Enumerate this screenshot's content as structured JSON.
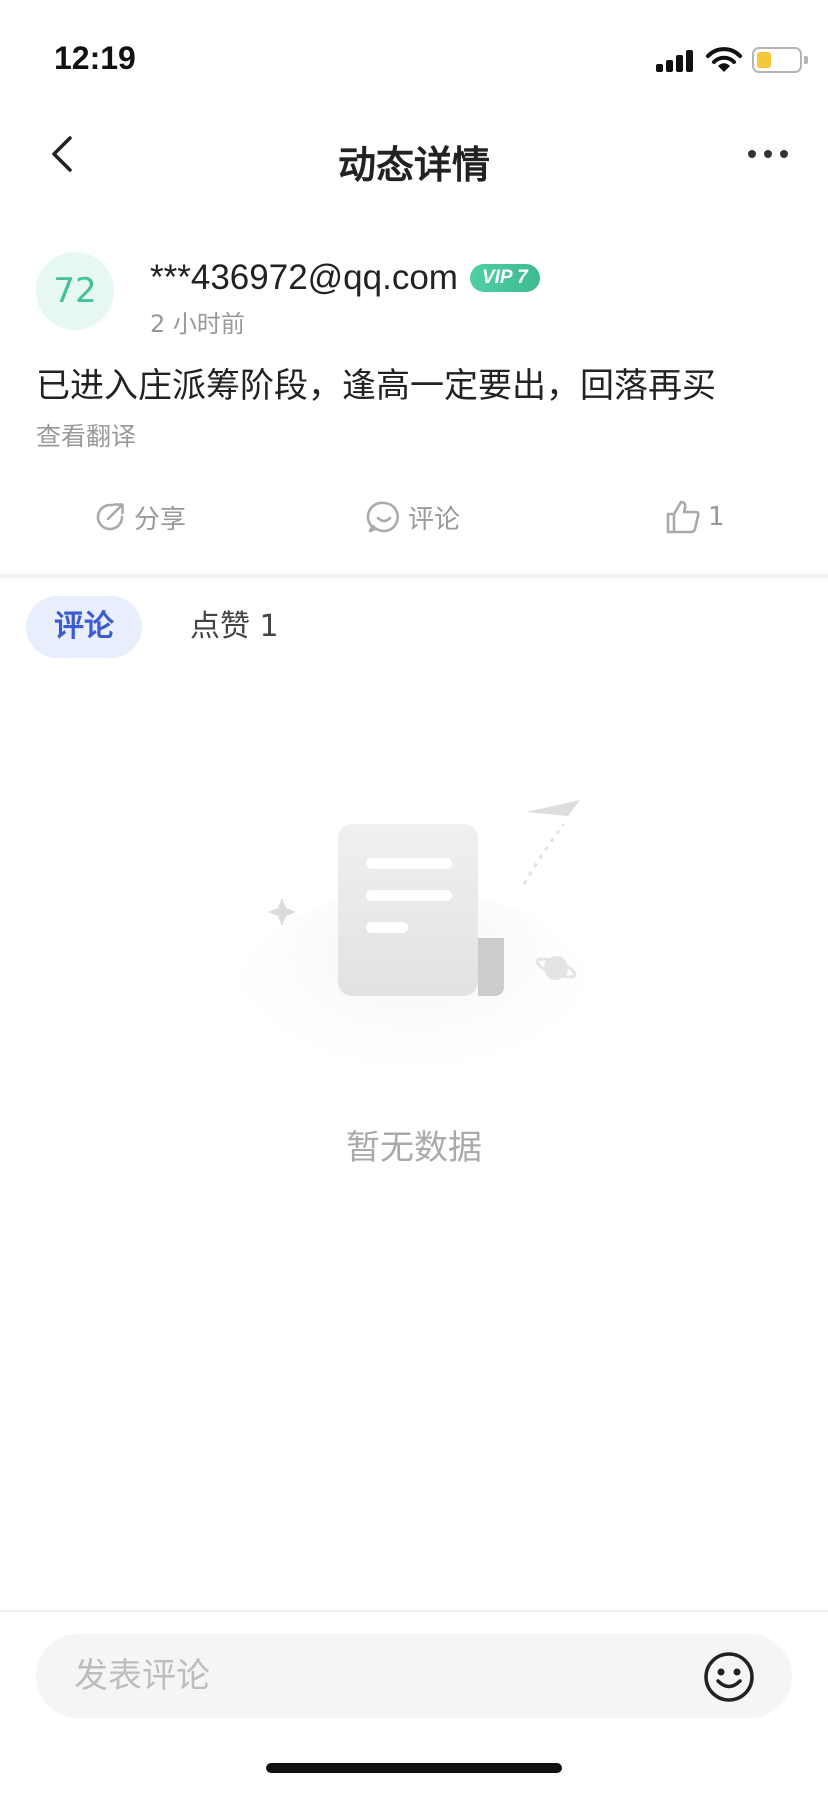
{
  "status_bar": {
    "time": "12:19"
  },
  "nav": {
    "title": "动态详情"
  },
  "post": {
    "avatar_text": "72",
    "username": "***436972@qq.com",
    "vip_badge": "VIP 7",
    "time": "2 小时前",
    "content": "已进入庄派筹阶段，逢高一定要出，回落再买",
    "translate_label": "查看翻译"
  },
  "actions": {
    "share_label": "分享",
    "comment_label": "评论",
    "like_count": "1"
  },
  "tabs": [
    {
      "label": "评论"
    },
    {
      "label": "点赞 1"
    }
  ],
  "empty_state": {
    "text": "暂无数据"
  },
  "comment_box": {
    "placeholder": "发表评论"
  },
  "colors": {
    "accent": "#3b5bd0",
    "vip": "#3dbb8f",
    "avatar_bg": "#e7f7f2"
  }
}
